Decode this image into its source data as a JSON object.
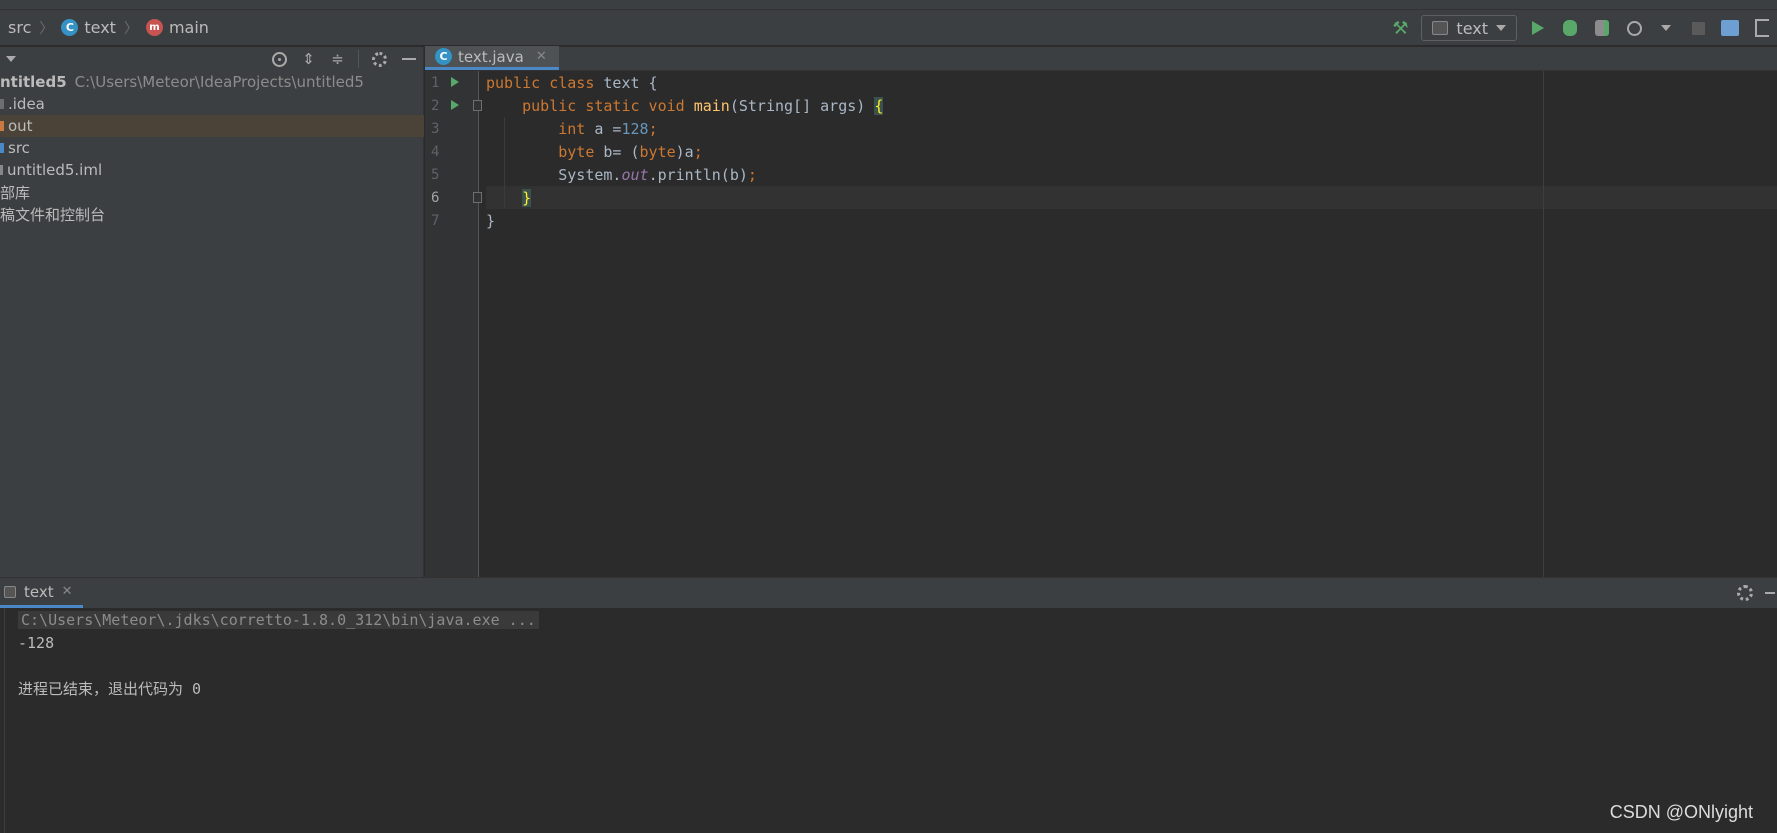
{
  "navbar": {
    "crumbs": [
      {
        "label": "src",
        "icon": "folder-icon"
      },
      {
        "label": "text",
        "icon": "class-icon"
      },
      {
        "label": "main",
        "icon": "method-icon"
      }
    ],
    "class_icon_letter": "C",
    "method_icon_letter": "m"
  },
  "toolbar": {
    "run_config": "text"
  },
  "project": {
    "root_name": "ntitled5",
    "root_path": "C:\\Users\\Meteor\\IdeaProjects\\untitled5",
    "items": [
      {
        "label": ".idea",
        "color": "#6e6e6e"
      },
      {
        "label": "out",
        "color": "#c77b40",
        "selected": true
      },
      {
        "label": "src",
        "color": "#4a88c7"
      },
      {
        "label": "untitled5.iml",
        "color": "#bbbbbb"
      },
      {
        "label": "部库"
      },
      {
        "label": "稿文件和控制台"
      }
    ]
  },
  "editor": {
    "tab_label": "text.java",
    "line_numbers": [
      "1",
      "2",
      "3",
      "4",
      "5",
      "6",
      "7"
    ],
    "current_line": 6
  },
  "run": {
    "tab_label": "text",
    "console": {
      "command": "C:\\Users\\Meteor\\.jdks\\corretto-1.8.0_312\\bin\\java.exe ...",
      "output": "-128",
      "exit_message": "进程已结束，退出代码为 0"
    }
  },
  "watermark": "CSDN @ONlyight"
}
